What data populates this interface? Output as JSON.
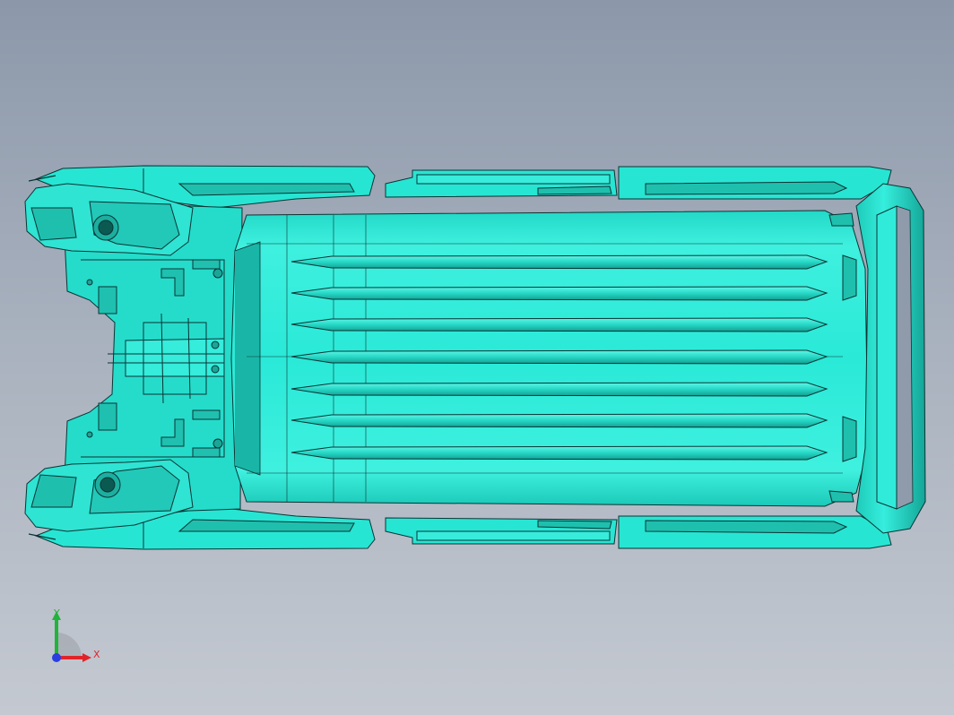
{
  "viewport": {
    "background_top": "#8c98aa",
    "background_bottom": "#c4c9d1"
  },
  "model": {
    "fill_color": "#27e5d3",
    "highlight_color": "#5ff3e6",
    "shadow_color": "#12a99b",
    "edge_color": "#0b3434"
  },
  "triad": {
    "x_label": "X",
    "y_label": "Y",
    "x_color": "#e0252a",
    "y_color": "#22b33a",
    "z_color": "#2a3fe0"
  }
}
